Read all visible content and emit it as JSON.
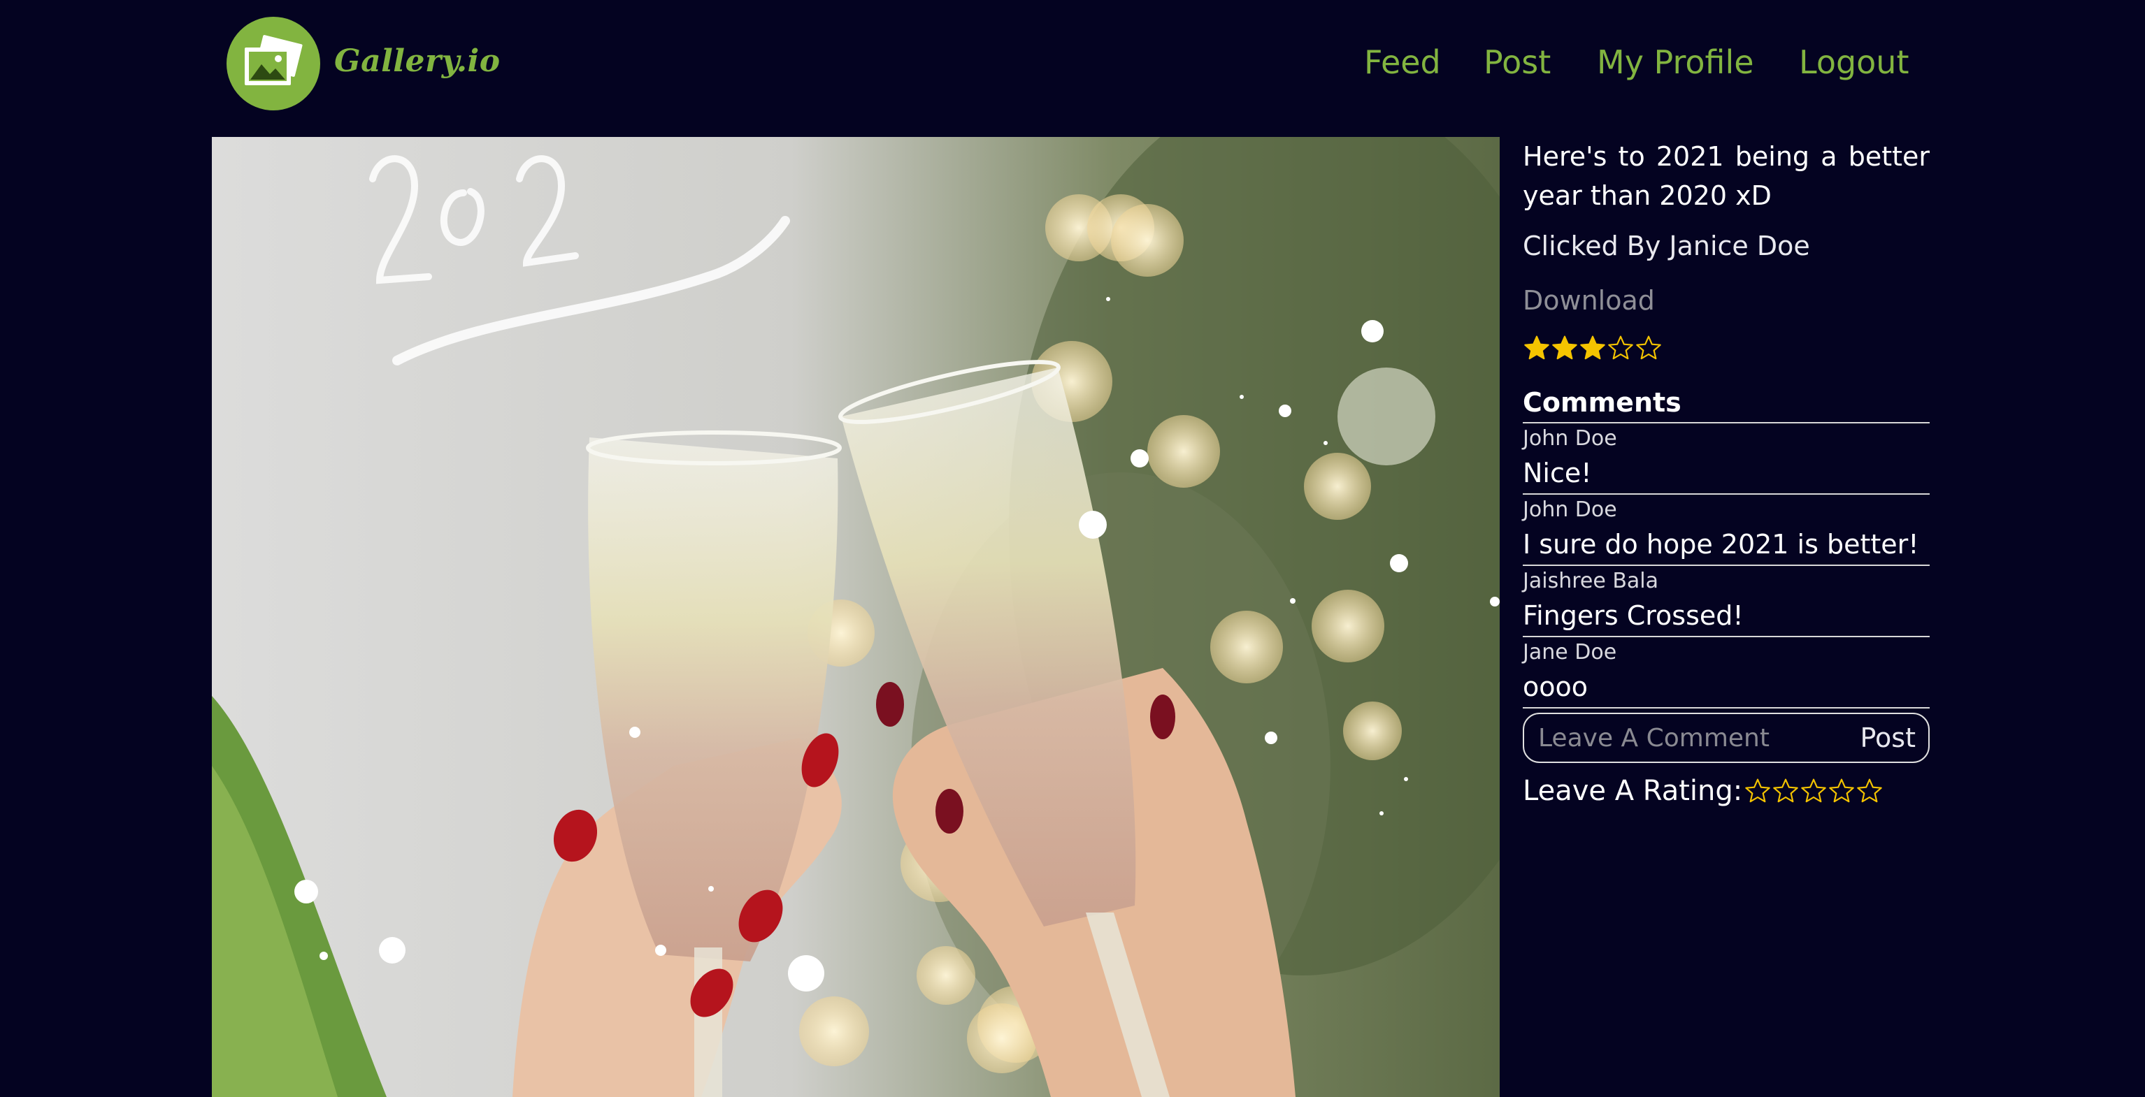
{
  "brand": {
    "name": "Gallery.io"
  },
  "nav": {
    "items": [
      "Feed",
      "Post",
      "My Profile",
      "Logout"
    ]
  },
  "colors": {
    "accent": "#82b440",
    "background": "#040321",
    "star": "#f5c400"
  },
  "post": {
    "caption": "Here's to 2021 being a better year than 2020 xD",
    "clicked_by": "Clicked By Janice Doe",
    "download_label": "Download",
    "rating": {
      "value": 3,
      "max": 5
    }
  },
  "comments": {
    "heading": "Comments",
    "items": [
      {
        "author": "John Doe",
        "text": "Nice!"
      },
      {
        "author": "John Doe",
        "text": "I sure do hope 2021 is better!"
      },
      {
        "author": "Jaishree Bala",
        "text": "Fingers Crossed!"
      },
      {
        "author": "Jane Doe",
        "text": "oooo"
      }
    ],
    "input_placeholder": "Leave A Comment",
    "post_label": "Post"
  },
  "rate": {
    "label": "Leave A Rating:",
    "value": 0,
    "max": 5
  },
  "image": {
    "drawn_text": "2021"
  }
}
